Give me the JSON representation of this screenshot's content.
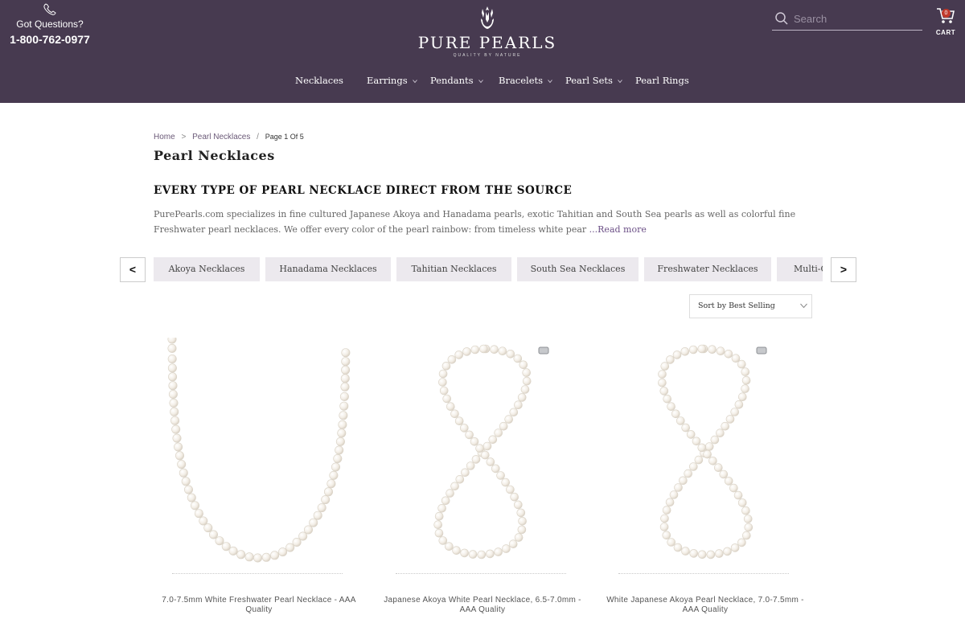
{
  "header": {
    "contact": {
      "question": "Got Questions?",
      "phone": "1-800-762-0977"
    },
    "logo": {
      "name": "PURE PEARLS",
      "tagline": "QUALITY BY NATURE"
    },
    "search": {
      "placeholder": "Search"
    },
    "cart": {
      "label": "CART",
      "count": "0"
    },
    "background_color": "#473a50"
  },
  "nav": [
    {
      "label": "Necklaces",
      "has_dropdown": false
    },
    {
      "label": "Earrings",
      "has_dropdown": true
    },
    {
      "label": "Pendants",
      "has_dropdown": true
    },
    {
      "label": "Bracelets",
      "has_dropdown": true
    },
    {
      "label": "Pearl Sets",
      "has_dropdown": true
    },
    {
      "label": "Pearl Rings",
      "has_dropdown": false
    }
  ],
  "breadcrumb": {
    "home": "Home",
    "separator1": ">",
    "section": "Pearl Necklaces",
    "separator2": "/",
    "page": "Page 1 Of 5"
  },
  "page_title": "Pearl Necklaces",
  "subheading": {
    "before": "EVERY TYPE OF ",
    "bold": "PEARL NECKLACE",
    "after": " DIRECT FROM THE SOURCE"
  },
  "description": {
    "text": "PurePearls.com specializes in fine cultured Japanese Akoya and Hanadama pearls, exotic Tahitian and South Sea pearls as well as colorful fine Freshwater pearl necklaces. We offer every color of the pearl rainbow: from timeless white pear ",
    "read_more": "...Read more"
  },
  "categories": {
    "prev": "<",
    "next": ">",
    "items": [
      "Akoya Necklaces",
      "Hanadama Necklaces",
      "Tahitian Necklaces",
      "South Sea Necklaces",
      "Freshwater Necklaces",
      "Multi-C"
    ]
  },
  "sort": {
    "selected": "Sort by Best Selling"
  },
  "products": [
    {
      "name": "7.0-7.5mm White Freshwater Pearl Necklace - AAA Quality"
    },
    {
      "name": "Japanese Akoya White Pearl Necklace, 6.5-7.0mm - AAA Quality"
    },
    {
      "name": "White Japanese Akoya Pearl Necklace, 7.0-7.5mm - AAA Quality"
    }
  ]
}
